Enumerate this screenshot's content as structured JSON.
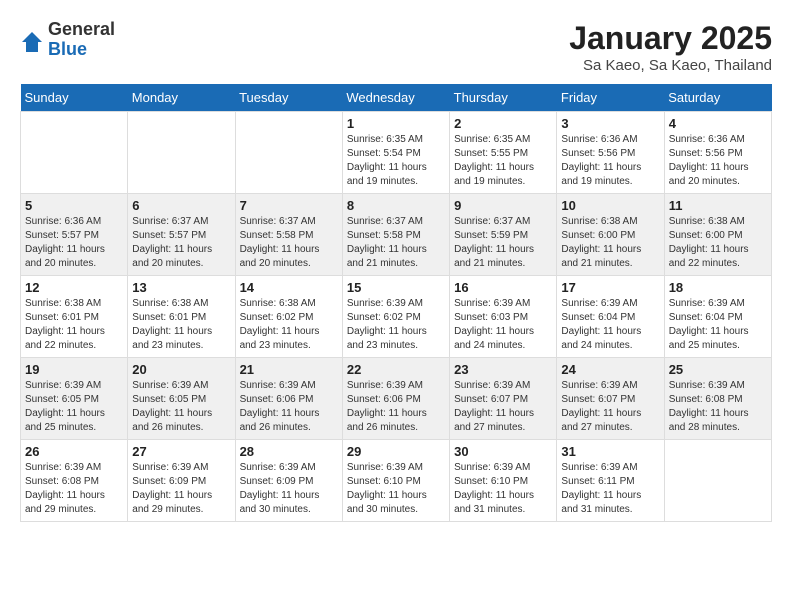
{
  "header": {
    "logo_general": "General",
    "logo_blue": "Blue",
    "month_title": "January 2025",
    "location": "Sa Kaeo, Sa Kaeo, Thailand"
  },
  "weekdays": [
    "Sunday",
    "Monday",
    "Tuesday",
    "Wednesday",
    "Thursday",
    "Friday",
    "Saturday"
  ],
  "weeks": [
    [
      {
        "day": "",
        "info": ""
      },
      {
        "day": "",
        "info": ""
      },
      {
        "day": "",
        "info": ""
      },
      {
        "day": "1",
        "info": "Sunrise: 6:35 AM\nSunset: 5:54 PM\nDaylight: 11 hours\nand 19 minutes."
      },
      {
        "day": "2",
        "info": "Sunrise: 6:35 AM\nSunset: 5:55 PM\nDaylight: 11 hours\nand 19 minutes."
      },
      {
        "day": "3",
        "info": "Sunrise: 6:36 AM\nSunset: 5:56 PM\nDaylight: 11 hours\nand 19 minutes."
      },
      {
        "day": "4",
        "info": "Sunrise: 6:36 AM\nSunset: 5:56 PM\nDaylight: 11 hours\nand 20 minutes."
      }
    ],
    [
      {
        "day": "5",
        "info": "Sunrise: 6:36 AM\nSunset: 5:57 PM\nDaylight: 11 hours\nand 20 minutes."
      },
      {
        "day": "6",
        "info": "Sunrise: 6:37 AM\nSunset: 5:57 PM\nDaylight: 11 hours\nand 20 minutes."
      },
      {
        "day": "7",
        "info": "Sunrise: 6:37 AM\nSunset: 5:58 PM\nDaylight: 11 hours\nand 20 minutes."
      },
      {
        "day": "8",
        "info": "Sunrise: 6:37 AM\nSunset: 5:58 PM\nDaylight: 11 hours\nand 21 minutes."
      },
      {
        "day": "9",
        "info": "Sunrise: 6:37 AM\nSunset: 5:59 PM\nDaylight: 11 hours\nand 21 minutes."
      },
      {
        "day": "10",
        "info": "Sunrise: 6:38 AM\nSunset: 6:00 PM\nDaylight: 11 hours\nand 21 minutes."
      },
      {
        "day": "11",
        "info": "Sunrise: 6:38 AM\nSunset: 6:00 PM\nDaylight: 11 hours\nand 22 minutes."
      }
    ],
    [
      {
        "day": "12",
        "info": "Sunrise: 6:38 AM\nSunset: 6:01 PM\nDaylight: 11 hours\nand 22 minutes."
      },
      {
        "day": "13",
        "info": "Sunrise: 6:38 AM\nSunset: 6:01 PM\nDaylight: 11 hours\nand 23 minutes."
      },
      {
        "day": "14",
        "info": "Sunrise: 6:38 AM\nSunset: 6:02 PM\nDaylight: 11 hours\nand 23 minutes."
      },
      {
        "day": "15",
        "info": "Sunrise: 6:39 AM\nSunset: 6:02 PM\nDaylight: 11 hours\nand 23 minutes."
      },
      {
        "day": "16",
        "info": "Sunrise: 6:39 AM\nSunset: 6:03 PM\nDaylight: 11 hours\nand 24 minutes."
      },
      {
        "day": "17",
        "info": "Sunrise: 6:39 AM\nSunset: 6:04 PM\nDaylight: 11 hours\nand 24 minutes."
      },
      {
        "day": "18",
        "info": "Sunrise: 6:39 AM\nSunset: 6:04 PM\nDaylight: 11 hours\nand 25 minutes."
      }
    ],
    [
      {
        "day": "19",
        "info": "Sunrise: 6:39 AM\nSunset: 6:05 PM\nDaylight: 11 hours\nand 25 minutes."
      },
      {
        "day": "20",
        "info": "Sunrise: 6:39 AM\nSunset: 6:05 PM\nDaylight: 11 hours\nand 26 minutes."
      },
      {
        "day": "21",
        "info": "Sunrise: 6:39 AM\nSunset: 6:06 PM\nDaylight: 11 hours\nand 26 minutes."
      },
      {
        "day": "22",
        "info": "Sunrise: 6:39 AM\nSunset: 6:06 PM\nDaylight: 11 hours\nand 26 minutes."
      },
      {
        "day": "23",
        "info": "Sunrise: 6:39 AM\nSunset: 6:07 PM\nDaylight: 11 hours\nand 27 minutes."
      },
      {
        "day": "24",
        "info": "Sunrise: 6:39 AM\nSunset: 6:07 PM\nDaylight: 11 hours\nand 27 minutes."
      },
      {
        "day": "25",
        "info": "Sunrise: 6:39 AM\nSunset: 6:08 PM\nDaylight: 11 hours\nand 28 minutes."
      }
    ],
    [
      {
        "day": "26",
        "info": "Sunrise: 6:39 AM\nSunset: 6:08 PM\nDaylight: 11 hours\nand 29 minutes."
      },
      {
        "day": "27",
        "info": "Sunrise: 6:39 AM\nSunset: 6:09 PM\nDaylight: 11 hours\nand 29 minutes."
      },
      {
        "day": "28",
        "info": "Sunrise: 6:39 AM\nSunset: 6:09 PM\nDaylight: 11 hours\nand 30 minutes."
      },
      {
        "day": "29",
        "info": "Sunrise: 6:39 AM\nSunset: 6:10 PM\nDaylight: 11 hours\nand 30 minutes."
      },
      {
        "day": "30",
        "info": "Sunrise: 6:39 AM\nSunset: 6:10 PM\nDaylight: 11 hours\nand 31 minutes."
      },
      {
        "day": "31",
        "info": "Sunrise: 6:39 AM\nSunset: 6:11 PM\nDaylight: 11 hours\nand 31 minutes."
      },
      {
        "day": "",
        "info": ""
      }
    ]
  ]
}
